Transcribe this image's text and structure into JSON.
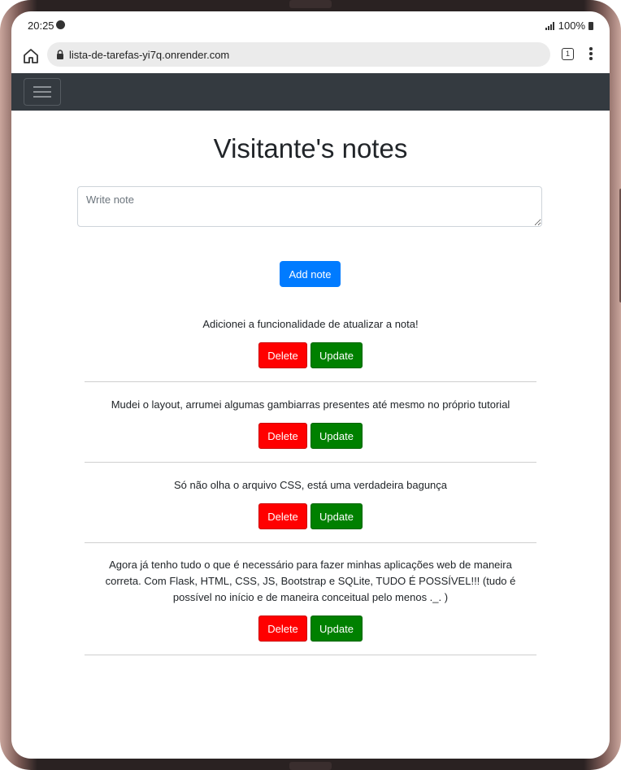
{
  "status_bar": {
    "time": "20:25",
    "battery": "100%"
  },
  "browser": {
    "url": "lista-de-tarefas-yi7q.onrender.com",
    "tab_count": "1"
  },
  "page": {
    "title": "Visitante's notes",
    "input_placeholder": "Write note",
    "add_label": "Add note"
  },
  "notes": [
    {
      "text": "Adicionei a funcionalidade de atualizar a nota!",
      "delete_label": "Delete",
      "update_label": "Update"
    },
    {
      "text": "Mudei o layout, arrumei algumas gambiarras presentes até mesmo no próprio tutorial",
      "delete_label": "Delete",
      "update_label": "Update"
    },
    {
      "text": "Só não olha o arquivo CSS, está uma verdadeira bagunça",
      "delete_label": "Delete",
      "update_label": "Update"
    },
    {
      "text": "Agora já tenho tudo o que é necessário para fazer minhas aplicações web de maneira correta. Com Flask, HTML, CSS, JS, Bootstrap e SQLite, TUDO É POSSÍVEL!!! (tudo é possível no início e de maneira conceitual pelo menos ._. )",
      "delete_label": "Delete",
      "update_label": "Update"
    }
  ],
  "colors": {
    "navbar": "#343a40",
    "primary": "#007bff",
    "delete": "#ff0000",
    "update": "#008000"
  },
  "icons": {
    "home": "home-icon",
    "lock": "lock-icon",
    "tabs": "tabs-icon",
    "menu": "more-vert-icon",
    "toggler": "hamburger-icon"
  }
}
